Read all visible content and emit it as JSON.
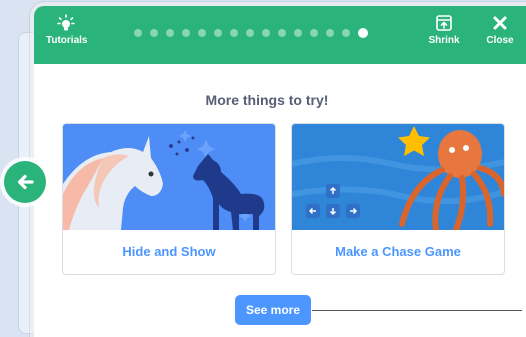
{
  "header": {
    "tutorials_label": "Tutorials",
    "shrink_label": "Shrink",
    "close_label": "Close",
    "progress_total_steps": 15,
    "progress_current_step": 15
  },
  "content": {
    "title": "More things to try!",
    "cards": [
      {
        "label": "Hide and Show"
      },
      {
        "label": "Make a Chase Game"
      }
    ],
    "see_more_label": "See more"
  },
  "colors": {
    "header_green": "#2ab37a",
    "accent_blue": "#4c97ff",
    "title_gray": "#575e75"
  },
  "icons": {
    "tutorials": "lightbulb-icon",
    "shrink": "shrink-icon",
    "close": "close-icon",
    "back": "left-arrow-icon"
  }
}
